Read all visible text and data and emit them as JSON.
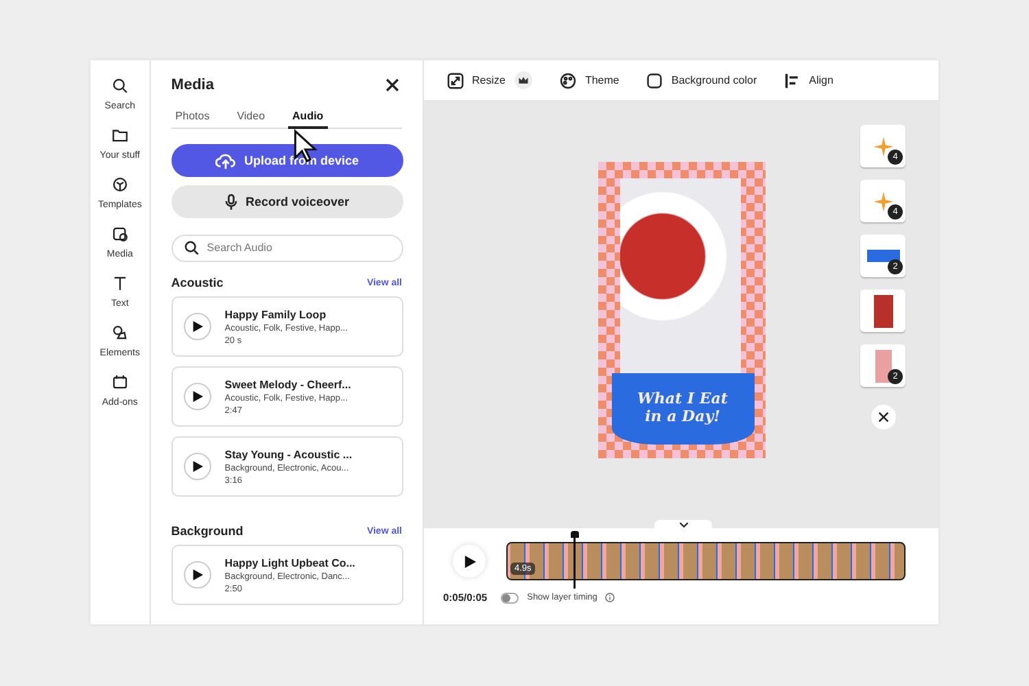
{
  "rail": [
    {
      "label": "Search"
    },
    {
      "label": "Your stuff"
    },
    {
      "label": "Templates"
    },
    {
      "label": "Media"
    },
    {
      "label": "Text"
    },
    {
      "label": "Elements"
    },
    {
      "label": "Add-ons"
    }
  ],
  "panel": {
    "title": "Media",
    "tabs": [
      {
        "label": "Photos",
        "selected": false
      },
      {
        "label": "Video",
        "selected": false
      },
      {
        "label": "Audio",
        "selected": true
      }
    ],
    "upload_button": "Upload from device",
    "record_button": "Record voiceover",
    "search": {
      "placeholder": "Search Audio"
    },
    "sections": [
      {
        "title": "Acoustic",
        "link": "View all",
        "tracks": [
          {
            "title": "Happy Family Loop",
            "tags": "Acoustic, Folk, Festive, Happ...",
            "duration": "20 s"
          },
          {
            "title": "Sweet Melody - Cheerf...",
            "tags": "Acoustic, Folk, Festive, Happ...",
            "duration": "2:47"
          },
          {
            "title": "Stay Young - Acoustic ...",
            "tags": "Background, Electronic, Acou...",
            "duration": "3:16"
          }
        ]
      },
      {
        "title": "Background",
        "link": "View all",
        "tracks": [
          {
            "title": "Happy Light Upbeat Co...",
            "tags": "Background, Electronic, Danc...",
            "duration": "2:50"
          }
        ]
      }
    ]
  },
  "toolbar": [
    {
      "label": "Resize",
      "premium": true
    },
    {
      "label": "Theme",
      "premium": false
    },
    {
      "label": "Background color",
      "premium": false
    },
    {
      "label": "Align",
      "premium": false
    }
  ],
  "design": {
    "title_line_1": "What I Eat",
    "title_line_2": "in a Day!"
  },
  "layers": [
    {
      "kind": "stars",
      "badge": "4"
    },
    {
      "kind": "stars",
      "badge": "4"
    },
    {
      "kind": "banner",
      "badge": "2"
    },
    {
      "kind": "photo"
    },
    {
      "kind": "block",
      "badge": "2"
    }
  ],
  "timeline": {
    "clip_duration": "4.9s",
    "time": "0:05/0:05",
    "layer_timing": {
      "label": "Show layer timing",
      "on": false
    }
  }
}
